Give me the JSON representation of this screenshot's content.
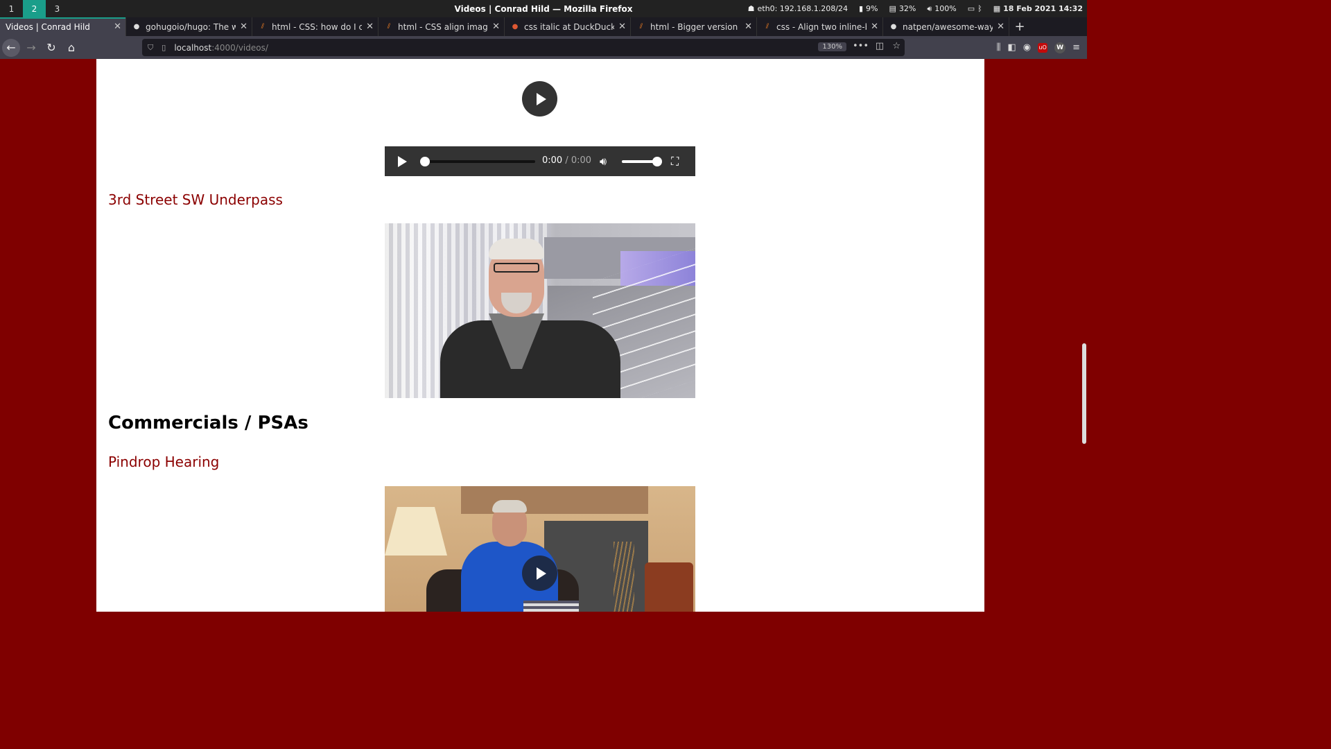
{
  "system_bar": {
    "workspaces": [
      "1",
      "2",
      "3"
    ],
    "active_workspace": "2",
    "window_title": "Videos | Conrad Hild — Mozilla Firefox",
    "network": "eth0: 192.168.1.208/24",
    "battery": "9%",
    "memory": "32%",
    "volume": "100%",
    "datetime": "18 Feb 2021 14:32"
  },
  "tabs": [
    {
      "label": "Videos | Conrad Hild",
      "icon": "none",
      "active": true
    },
    {
      "label": "gohugoio/hugo: The world's fastest",
      "icon": "github-icon",
      "active": false
    },
    {
      "label": "html - CSS: how do I create",
      "icon": "stackoverflow-icon",
      "active": false
    },
    {
      "label": "html - CSS align images and",
      "icon": "stackoverflow-icon",
      "active": false
    },
    {
      "label": "css italic at DuckDuckGo",
      "icon": "duckduckgo-icon",
      "active": false
    },
    {
      "label": "html - Bigger version of &",
      "icon": "stackoverflow-icon",
      "active": false
    },
    {
      "label": "css - Align two inline-block",
      "icon": "stackoverflow-icon",
      "active": false
    },
    {
      "label": "natpen/awesome-wayland",
      "icon": "github-icon",
      "active": false
    }
  ],
  "navbar": {
    "url_host": "localhost",
    "url_path": ":4000/videos/",
    "zoom": "130%"
  },
  "player": {
    "current_time": "0:00",
    "separator": " / ",
    "duration": "0:00",
    "progress": 0,
    "volume_level": 1.0
  },
  "sections": {
    "video1_title": "3rd Street SW Underpass",
    "heading_commercials": "Commercials / PSAs",
    "video2_title": "Pindrop Hearing"
  },
  "colors": {
    "page_bg": "#7f0000",
    "link_red": "#8b0000",
    "workspace_active": "#1a9e8a"
  }
}
